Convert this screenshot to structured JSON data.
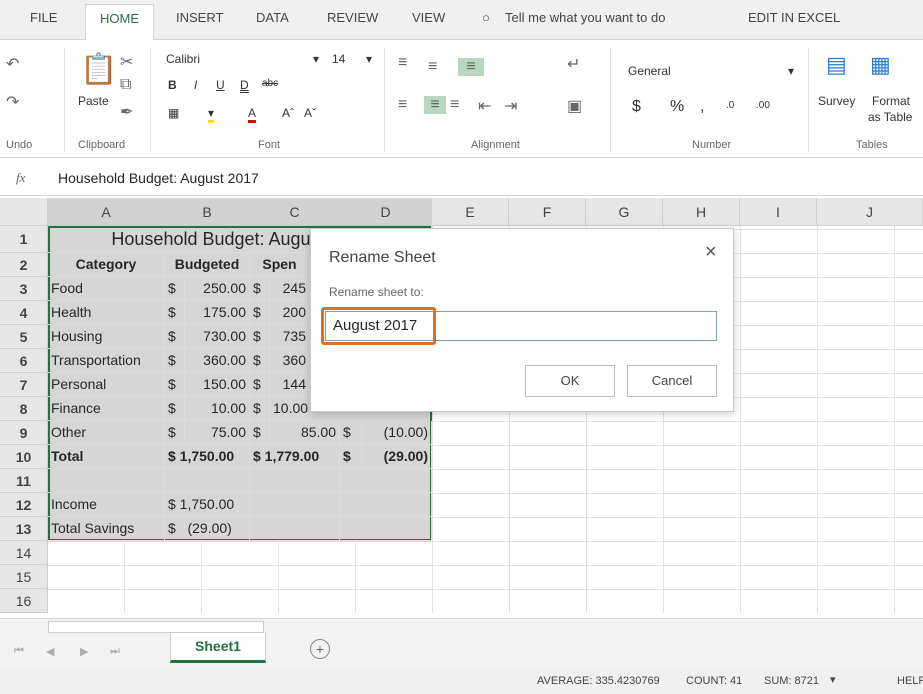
{
  "tabs": [
    "FILE",
    "HOME",
    "INSERT",
    "DATA",
    "REVIEW",
    "VIEW",
    "Tell me what you want to do",
    "EDIT IN EXCEL"
  ],
  "ribbon": {
    "undo": "Undo",
    "clipboard": "Clipboard",
    "paste": "Paste",
    "font_group": "Font",
    "font_name": "Calibri",
    "font_size": "14",
    "alignment": "Alignment",
    "number_group": "Number",
    "number_format": "General",
    "currency": "$",
    "percent": "%",
    "comma": ",",
    "tables": "Tables",
    "survey": "Survey",
    "format_as_table_1": "Format",
    "format_as_table_2": "as Table"
  },
  "formula": {
    "fx": "fx",
    "content": "Household Budget: August 2017"
  },
  "columns": [
    "A",
    "B",
    "C",
    "D",
    "E",
    "F",
    "G",
    "H",
    "I",
    "J"
  ],
  "rows": [
    "1",
    "2",
    "3",
    "4",
    "5",
    "6",
    "7",
    "8",
    "9",
    "10",
    "11",
    "12",
    "13",
    "14",
    "15",
    "16"
  ],
  "sheet": {
    "title": "Household Budget: Augu",
    "headers": [
      "Category",
      "Budgeted",
      "Spen"
    ],
    "data": [
      [
        "Food",
        "$",
        "250.00",
        "$",
        "245"
      ],
      [
        "Health",
        "$",
        "175.00",
        "$",
        "200"
      ],
      [
        "Housing",
        "$",
        "730.00",
        "$",
        "735"
      ],
      [
        "Transportation",
        "$",
        "360.00",
        "$",
        "360"
      ],
      [
        "Personal",
        "$",
        "150.00",
        "$",
        "144"
      ],
      [
        "Finance",
        "$",
        "10.00",
        "$",
        "10.00"
      ],
      [
        "Other",
        "$",
        "75.00",
        "$",
        "85.00",
        "$",
        "(10.00)"
      ],
      [
        "Total",
        "$ 1,750.00",
        "",
        "$ 1,779.00",
        "",
        "$",
        "(29.00)"
      ]
    ],
    "income_label": "Income",
    "income_value": "$ 1,750.00",
    "savings_label": "Total Savings",
    "savings_value": "$   (29.00)"
  },
  "dialog": {
    "title": "Rename Sheet",
    "close": "×",
    "label": "Rename sheet to:",
    "value": "August 2017",
    "ok": "OK",
    "cancel": "Cancel",
    "highlight_color": "#e07020"
  },
  "sheetbar": {
    "sheet_tab": "Sheet1",
    "add": "+"
  },
  "status": {
    "average": "AVERAGE: 335.4230769",
    "count": "COUNT: 41",
    "sum": "SUM: 8721",
    "help": "HELP"
  },
  "colors": {
    "accent": "#217346"
  }
}
